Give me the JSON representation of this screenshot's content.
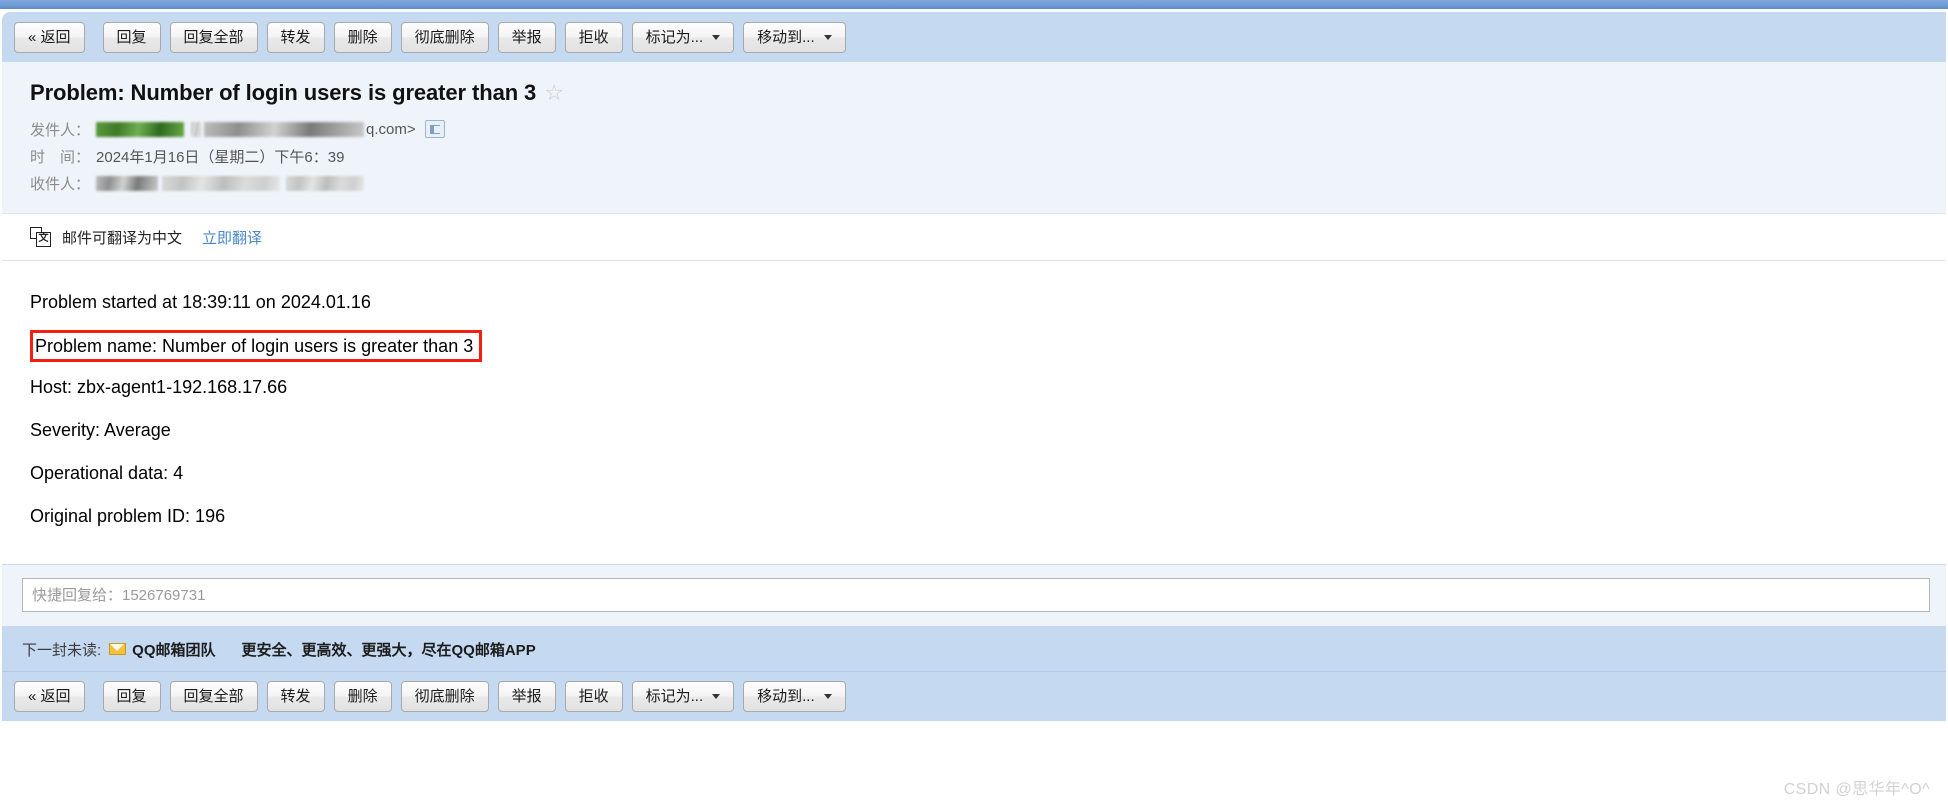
{
  "window": {
    "app_name": "QQ邮箱",
    "accent_color": "#6e9bd4",
    "toolbar_bg": "#c5d9f1"
  },
  "toolbar": {
    "buttons": [
      {
        "label": "« 返回",
        "name": "back-button",
        "has_caret": false
      },
      {
        "label": "回复",
        "name": "reply-button",
        "has_caret": false
      },
      {
        "label": "回复全部",
        "name": "reply-all-button",
        "has_caret": false
      },
      {
        "label": "转发",
        "name": "forward-button",
        "has_caret": false
      },
      {
        "label": "删除",
        "name": "delete-button",
        "has_caret": false
      },
      {
        "label": "彻底删除",
        "name": "permanent-delete-button",
        "has_caret": false
      },
      {
        "label": "举报",
        "name": "report-button",
        "has_caret": false
      },
      {
        "label": "拒收",
        "name": "reject-button",
        "has_caret": false
      },
      {
        "label": "标记为...",
        "name": "mark-as-dropdown",
        "has_caret": true
      },
      {
        "label": "移动到...",
        "name": "move-to-dropdown",
        "has_caret": true
      }
    ]
  },
  "mail_header": {
    "subject": "Problem: Number of login users is greater than 3",
    "star_glyph": "☆",
    "from_label": "发件人：",
    "from_email_suffix": "q.com>",
    "date_label": "时　间：",
    "date_value": "2024年1月16日（星期二）下午6：39",
    "to_label": "收件人："
  },
  "translate_bar": {
    "icon_glyph": "文",
    "message": "邮件可翻译为中文",
    "action_link": "立即翻译",
    "link_color": "#4a87c8"
  },
  "mail_body": {
    "lines": [
      {
        "text": "Problem started at 18:39:11 on 2024.01.16",
        "highlighted": false
      },
      {
        "text": "Problem name: Number of login users is greater than 3",
        "highlighted": true
      },
      {
        "text": "Host: zbx-agent1-192.168.17.66",
        "highlighted": false
      },
      {
        "text": "Severity: Average",
        "highlighted": false
      },
      {
        "text": "Operational data: 4",
        "highlighted": false
      },
      {
        "text": "Original problem ID: 196",
        "highlighted": false
      }
    ],
    "highlight_color": "#f41f10"
  },
  "quick_reply": {
    "placeholder": "快捷回复给：1526769731",
    "value": ""
  },
  "next_unread": {
    "label": "下一封未读:",
    "sender": "QQ邮箱团队",
    "subject": "更安全、更高效、更强大，尽在QQ邮箱APP"
  },
  "watermark": {
    "text": "CSDN @思华年^O^"
  }
}
